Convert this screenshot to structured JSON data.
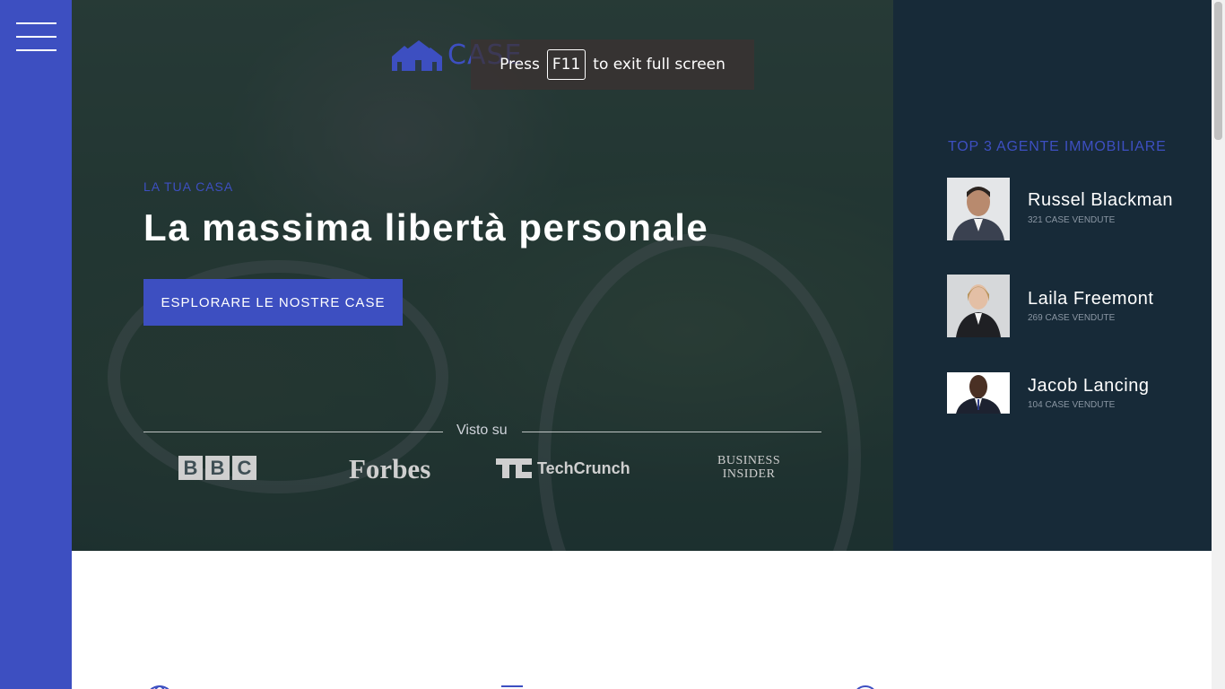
{
  "sidebar": {
    "menu_icon": "hamburger-icon"
  },
  "logo": {
    "text": "CASE",
    "icon": "houses-icon",
    "color": "#3d4fc1"
  },
  "fullscreen_notice": {
    "prefix": "Press",
    "key": "F11",
    "suffix": "to exit full screen"
  },
  "hero": {
    "eyebrow": "LA TUA CASA",
    "headline": "La massima libertà personale",
    "cta_label": "ESPLORARE LE NOSTRE CASE",
    "seen_on_label": "Visto su",
    "press": [
      "BBC",
      "Forbes",
      "TechCrunch",
      "Business Insider"
    ]
  },
  "agents": {
    "title": "TOP 3 AGENTE IMMOBILIARE",
    "items": [
      {
        "name": "Russel Blackman",
        "sales": "321 CASE VENDUTE"
      },
      {
        "name": "Laila Freemont",
        "sales": "269 CASE VENDUTE"
      },
      {
        "name": "Jacob Lancing",
        "sales": "104 CASE VENDUTE"
      }
    ]
  },
  "colors": {
    "accent": "#3d4fc1",
    "agents_bg": "#172a38",
    "white": "#ffffff"
  }
}
